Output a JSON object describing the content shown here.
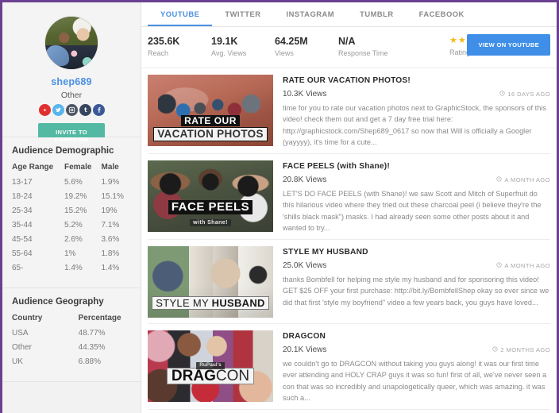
{
  "theme": {
    "frame_border": "#6b4090",
    "accent_blue": "#4a90e2",
    "invite_green": "#53b9a3",
    "star_gold": "#f6b91a",
    "view_button_blue": "#3f8fe8"
  },
  "sidebar": {
    "profile": {
      "username": "shep689",
      "user_type": "Other",
      "avatar_name": "profile-avatar",
      "invite_label": "INVITE TO CAMPAIGN",
      "socials": [
        {
          "name": "youtube-icon",
          "label": "YouTube",
          "color": "#e02f2f"
        },
        {
          "name": "twitter-icon",
          "label": "Twitter",
          "color": "#59b6ec"
        },
        {
          "name": "instagram-icon",
          "label": "Instagram",
          "color": "#4e5665"
        },
        {
          "name": "tumblr-icon",
          "label": "Tumblr",
          "color": "#36465d"
        },
        {
          "name": "facebook-icon",
          "label": "Facebook",
          "color": "#3b5998"
        }
      ]
    },
    "demographic": {
      "title": "Audience Demographic",
      "columns": [
        "Age Range",
        "Female",
        "Male"
      ],
      "rows": [
        [
          "13-17",
          "5.6%",
          "1.9%"
        ],
        [
          "18-24",
          "19.2%",
          "15.1%"
        ],
        [
          "25-34",
          "15.2%",
          "19%"
        ],
        [
          "35-44",
          "5.2%",
          "7.1%"
        ],
        [
          "45-54",
          "2.6%",
          "3.6%"
        ],
        [
          "55-64",
          "1%",
          "1.8%"
        ],
        [
          "65-",
          "1.4%",
          "1.4%"
        ]
      ]
    },
    "geography": {
      "title": "Audience Geography",
      "columns": [
        "Country",
        "Percentage"
      ],
      "rows": [
        [
          "USA",
          "48.77%"
        ],
        [
          "Other",
          "44.35%"
        ],
        [
          "UK",
          "6.88%"
        ]
      ]
    }
  },
  "main": {
    "tabs": [
      {
        "label": "YOUTUBE",
        "active": true
      },
      {
        "label": "TWITTER",
        "active": false
      },
      {
        "label": "INSTAGRAM",
        "active": false
      },
      {
        "label": "TUMBLR",
        "active": false
      },
      {
        "label": "FACEBOOK",
        "active": false
      }
    ],
    "stats": [
      {
        "value": "235.6K",
        "label": "Reach"
      },
      {
        "value": "19.1K",
        "label": "Avg. Views"
      },
      {
        "value": "64.25M",
        "label": "Views"
      },
      {
        "value": "N/A",
        "label": "Response Time"
      }
    ],
    "rating": {
      "label": "Rating",
      "stars": "★★★★★",
      "count": 5
    },
    "view_button": "VIEW ON YOUTUBE",
    "videos": [
      {
        "title": "RATE OUR VACATION PHOTOS!",
        "views": "10.3K Views",
        "ago": "16 DAYS AGO",
        "description": "time for you to rate our vacation photos next to GraphicStock, the sponsors of this video! check them out and get a 7 day free trial here: http://graphicstock.com/Shep689_0617 so now that Will is officially a Googler (yayyyy), it's time for a cute...",
        "thumb_caption_line1": "RATE OUR",
        "thumb_caption_line2": "VACATION PHOTOS"
      },
      {
        "title": "FACE PEELS (with Shane)!",
        "views": "20.8K Views",
        "ago": "A MONTH AGO",
        "description": "LET'S DO FACE PEELS (with Shane)! we saw Scott and Mitch of Superfruit do this hilarious video where they tried out these charcoal peel (i believe they're the 'shills black mask\") masks. I had already seen some other posts about it and wanted to try...",
        "thumb_caption_line1": "FACE PEELS",
        "thumb_caption_line2": "with Shane!"
      },
      {
        "title": "STYLE MY HUSBAND",
        "views": "25.0K Views",
        "ago": "A MONTH AGO",
        "description": "thanks Bombfell for helping me style my husband and for sponsoring this video! GET $25 OFF your first purchase: http://bit.ly/BombfellShep okay so ever since we did that first 'style my boyfriend\" video a few years back, you guys have loved...",
        "thumb_caption_line1": "STYLE MY",
        "thumb_caption_line2": "HUSBAND"
      },
      {
        "title": "DRAGCON",
        "views": "20.1K Views",
        "ago": "2 MONTHS AGO",
        "description": "we couldn't go to DRAGCON without taking you guys along! it was our first time ever attending and HOLY CRAP guys it was so fun! first of all, we've never seen a con that was so incredibly and unapologetically queer, which was amazing. it was such a...",
        "thumb_caption_line1": "RuPaul's",
        "thumb_caption_line2": "DRAGCON"
      }
    ]
  }
}
